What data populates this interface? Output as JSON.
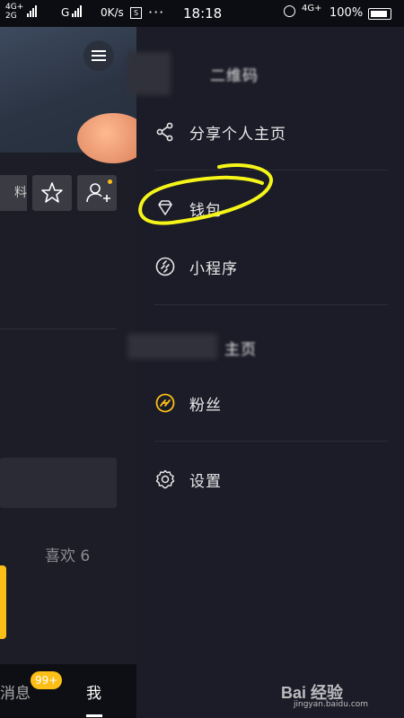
{
  "status_bar": {
    "sim1": "4G+",
    "sim2": "2G",
    "carrier_sig": "G",
    "net_speed": "0K/s",
    "s_icon": "S",
    "more": "···",
    "time": "18:18",
    "sig_right": "4G+",
    "battery": "100%"
  },
  "profile": {
    "edit_label": "料",
    "likes_label": "喜欢 6",
    "nav": {
      "messages": "消息",
      "messages_badge": "99+",
      "me": "我"
    }
  },
  "drawer": {
    "items": [
      {
        "label": "二维码",
        "icon": "qr-icon"
      },
      {
        "label": "分享个人主页",
        "icon": "share-icon"
      },
      {
        "label": "钱包",
        "icon": "diamond-icon"
      },
      {
        "label": "小程序",
        "icon": "link-icon"
      },
      {
        "label": "主页",
        "icon": ""
      },
      {
        "label": "粉丝",
        "icon": "fans-icon"
      },
      {
        "label": "设置",
        "icon": "settings-icon"
      }
    ]
  },
  "watermark": {
    "text": "Bai 经验",
    "url": "jingyan.baidu.com"
  },
  "colors": {
    "drawer_bg": "#1b1c27",
    "accent_yellow": "#fcbf18",
    "annotation_yellow": "#f5f51a"
  }
}
